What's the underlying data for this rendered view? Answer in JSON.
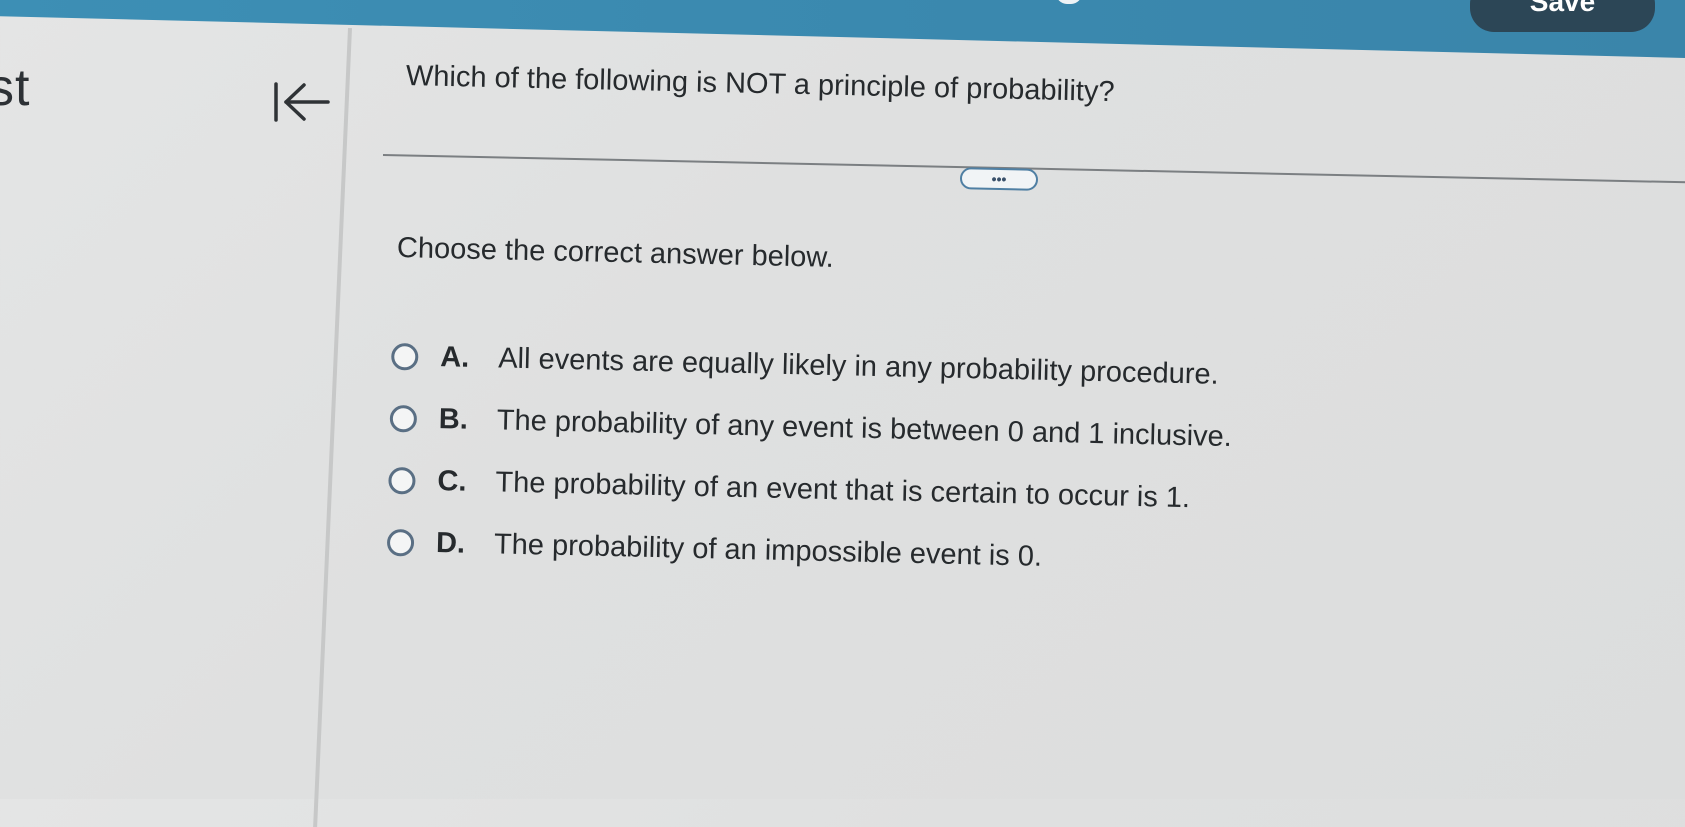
{
  "header": {
    "save_label": "Save"
  },
  "left_pane": {
    "title_fragment": "st"
  },
  "question": {
    "text": "Which of the following is NOT a principle of probability?",
    "more_label": "•••",
    "instruction": "Choose the correct answer below."
  },
  "options": [
    {
      "letter": "A.",
      "text": "All events are equally likely in any probability procedure."
    },
    {
      "letter": "B.",
      "text": "The probability of any event is between 0 and 1 inclusive."
    },
    {
      "letter": "C.",
      "text": "The probability of an event that is certain to occur is 1."
    },
    {
      "letter": "D.",
      "text": "The probability of an impossible event is 0."
    }
  ],
  "colors": {
    "header_bar": "#3d8fb5",
    "save_button": "#2c4656",
    "radio_border": "#5a6f84"
  },
  "icons": {
    "collapse": "collapse-left-icon",
    "more": "more-dots-icon"
  }
}
